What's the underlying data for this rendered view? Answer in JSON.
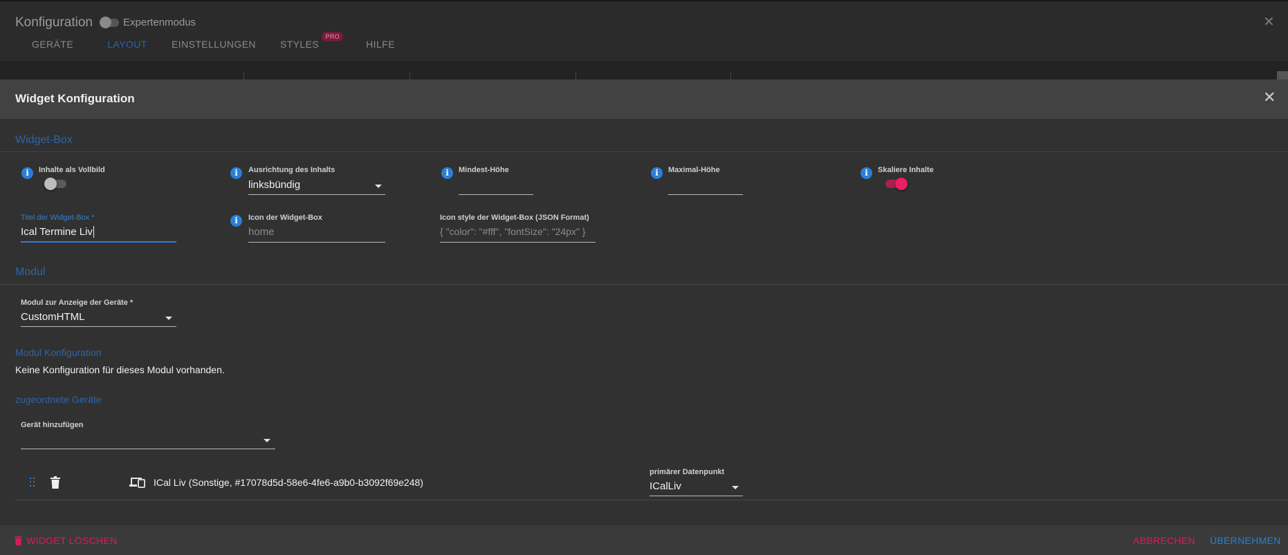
{
  "colors": {
    "accent_blue": "#2d65a8",
    "info_blue": "#2a7fd4",
    "focus_blue": "#2f7fd6",
    "danger_pink": "#d81b60",
    "switch_on": "#e91e63"
  },
  "config_dialog": {
    "title": "Konfiguration",
    "expert_mode_label": "Expertenmodus",
    "expert_mode_on": false,
    "tabs": [
      {
        "label": "GERÄTE"
      },
      {
        "label": "LAYOUT",
        "active": true
      },
      {
        "label": "EINSTELLUNGEN"
      },
      {
        "label": "STYLES",
        "badge": "PRO"
      },
      {
        "label": "HILFE"
      }
    ],
    "close_icon": "close-icon"
  },
  "widget_dialog": {
    "title": "Widget Konfiguration",
    "close_icon": "close-icon",
    "widget_box": {
      "section_title": "Widget-Box",
      "fullscreen": {
        "label": "Inhalte als Vollbild",
        "on": false
      },
      "alignment": {
        "label": "Ausrichtung des Inhalts",
        "value": "linksbündig"
      },
      "min_height": {
        "label": "Mindest-Höhe",
        "value": ""
      },
      "max_height": {
        "label": "Maximal-Höhe",
        "value": ""
      },
      "scale": {
        "label": "Skaliere Inhalte",
        "on": true
      },
      "title_field": {
        "label": "Titel der Widget-Box *",
        "value": "Ical Termine Liv"
      },
      "icon_field": {
        "label": "Icon der Widget-Box",
        "placeholder": "home"
      },
      "icon_style_field": {
        "label": "Icon style der Widget-Box (JSON Format)",
        "placeholder": "{ \"color\": \"#fff\", \"fontSize\": \"24px\" }"
      }
    },
    "module": {
      "section_title": "Modul",
      "module_select": {
        "label": "Modul zur Anzeige der Geräte *",
        "value": "CustomHTML"
      },
      "config_title": "Modul Konfiguration",
      "config_text": "Keine Konfiguration für dieses Modul vorhanden.",
      "devices_title": "zugeordnete Geräte",
      "add_device": {
        "label": "Gerät hinzufügen",
        "value": ""
      },
      "devices": [
        {
          "name": "ICal Liv (Sonstige, #17078d5d-58e6-4fe6-a9b0-b3092f69e248)",
          "primary_label": "primärer Datenpunkt",
          "primary_value": "ICalLiv"
        }
      ]
    },
    "footer": {
      "delete_label": "WIDGET LÖSCHEN",
      "cancel_label": "ABBRECHEN",
      "apply_label": "ÜBERNEHMEN"
    }
  }
}
